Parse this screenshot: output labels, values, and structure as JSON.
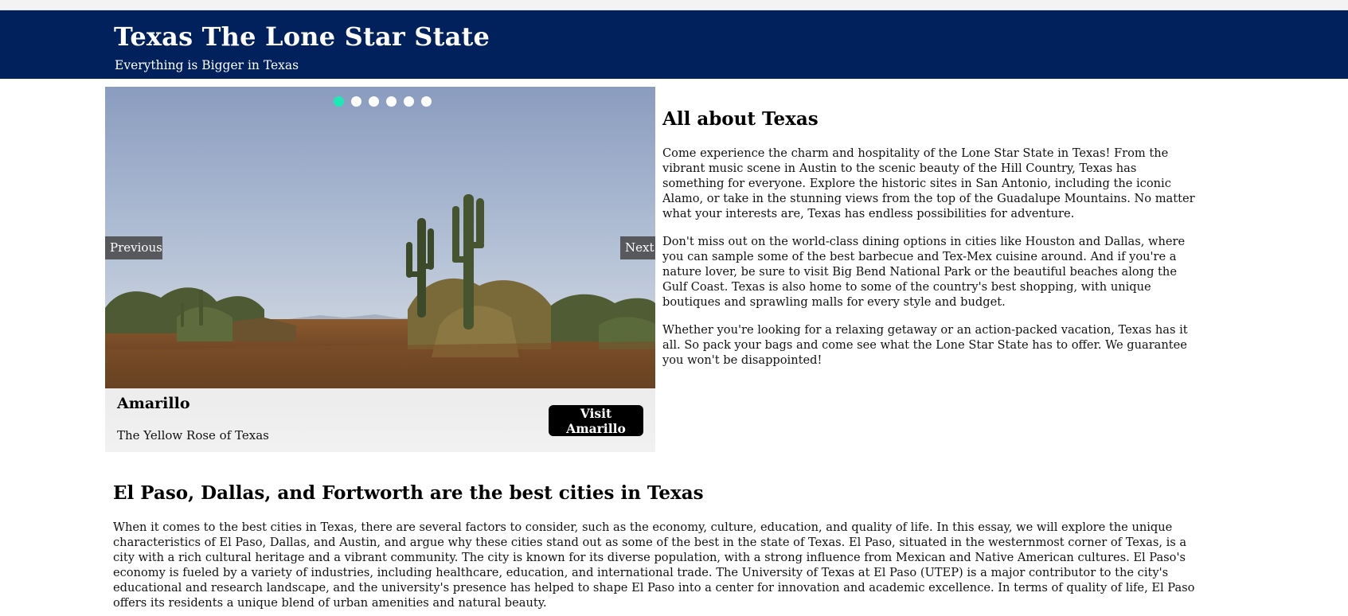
{
  "header": {
    "title": "Texas The Lone Star State",
    "subtitle": "Everything is Bigger in Texas",
    "background_color": "#00215c"
  },
  "carousel": {
    "slide_count": 6,
    "active_index": 0,
    "active_dot_color": "#1de9b6",
    "prev_label": "Previous",
    "next_label": "Next",
    "caption": {
      "title": "Amarillo",
      "text": "The Yellow Rose of Texas",
      "button_label": "Visit Amarillo"
    }
  },
  "about": {
    "heading": "All about Texas",
    "paragraphs": [
      "Come experience the charm and hospitality of the Lone Star State in Texas! From the vibrant music scene in Austin to the scenic beauty of the Hill Country, Texas has something for everyone. Explore the historic sites in San Antonio, including the iconic Alamo, or take in the stunning views from the top of the Guadalupe Mountains. No matter what your interests are, Texas has endless possibilities for adventure.",
      "Don't miss out on the world-class dining options in cities like Houston and Dallas, where you can sample some of the best barbecue and Tex-Mex cuisine around. And if you're a nature lover, be sure to visit Big Bend National Park or the beautiful beaches along the Gulf Coast. Texas is also home to some of the country's best shopping, with unique boutiques and sprawling malls for every style and budget.",
      "Whether you're looking for a relaxing getaway or an action-packed vacation, Texas has it all. So pack your bags and come see what the Lone Star State has to offer. We guarantee you won't be disappointed!"
    ]
  },
  "best_cities": {
    "heading": "El Paso, Dallas, and Fortworth are the best cities in Texas",
    "paragraph": "When it comes to the best cities in Texas, there are several factors to consider, such as the economy, culture, education, and quality of life. In this essay, we will explore the unique characteristics of El Paso, Dallas, and Austin, and argue why these cities stand out as some of the best in the state of Texas. El Paso, situated in the westernmost corner of Texas, is a city with a rich cultural heritage and a vibrant community. The city is known for its diverse population, with a strong influence from Mexican and Native American cultures. El Paso's economy is fueled by a variety of industries, including healthcare, education, and international trade. The University of Texas at El Paso (UTEP) is a major contributor to the city's educational and research landscape, and the university's presence has helped to shape El Paso into a center for innovation and academic excellence. In terms of quality of life, El Paso offers its residents a unique blend of urban amenities and natural beauty."
  }
}
